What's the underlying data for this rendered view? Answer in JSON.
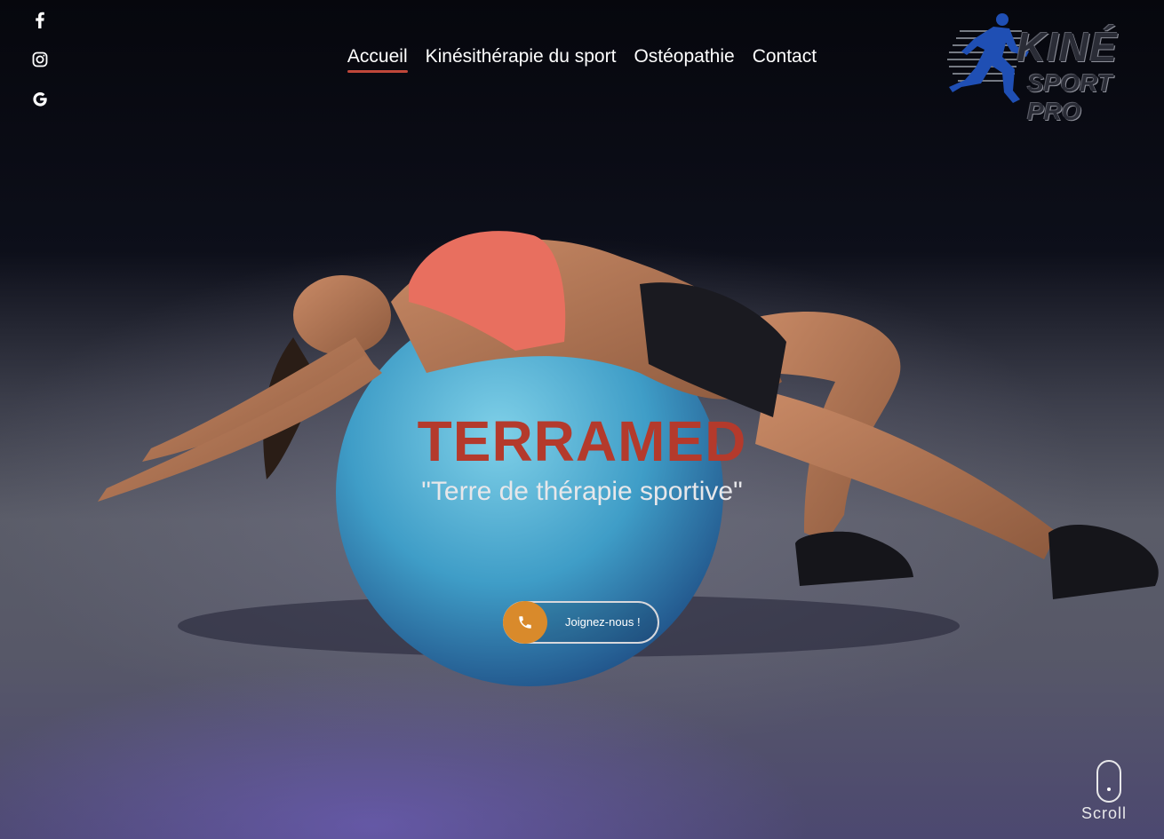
{
  "social": {
    "items": [
      {
        "name": "facebook",
        "icon": "facebook-icon"
      },
      {
        "name": "instagram",
        "icon": "instagram-icon"
      },
      {
        "name": "google",
        "icon": "google-icon"
      }
    ]
  },
  "nav": {
    "items": [
      {
        "label": "Accueil",
        "active": true
      },
      {
        "label": "Kinésithérapie du sport",
        "active": false
      },
      {
        "label": "Ostéopathie",
        "active": false
      },
      {
        "label": "Contact",
        "active": false
      }
    ]
  },
  "logo": {
    "line1": "KINÉ",
    "line2": "SPORT PRO",
    "icon": "runner-icon"
  },
  "hero": {
    "title": "TERRAMED",
    "tagline": "\"Terre de thérapie sportive\""
  },
  "cta": {
    "label": "Joignez-nous !",
    "icon": "phone-icon"
  },
  "scroll": {
    "label": "Scroll",
    "icon": "mouse-icon"
  },
  "colors": {
    "accent": "#c0473a",
    "title": "#b43a2c",
    "cta_circle": "#d98a2b",
    "logo_blue": "#1f4fb4"
  }
}
